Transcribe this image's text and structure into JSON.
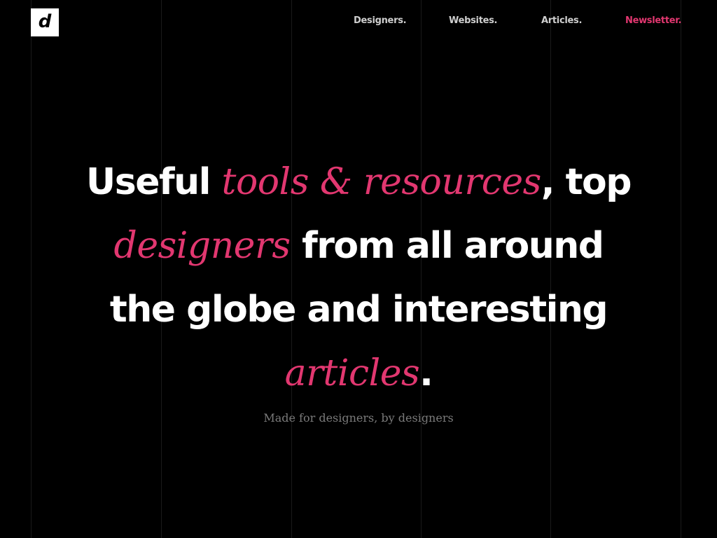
{
  "logo": {
    "letter": "d"
  },
  "nav": {
    "items": [
      {
        "label": "Designers."
      },
      {
        "label": "Websites."
      },
      {
        "label": "Articles."
      },
      {
        "label": "Newsletter."
      }
    ]
  },
  "hero": {
    "line1": {
      "a": "Useful ",
      "em": "tools & resources",
      "b": ", top"
    },
    "line2": {
      "em": "designers",
      "b": " from all around"
    },
    "line3": {
      "b": "the globe and interesting"
    },
    "line4": {
      "em": "articles",
      "b": "."
    }
  },
  "tagline": "Made for designers, by designers",
  "colors": {
    "background": "#000000",
    "accent": "#e23770",
    "text": "#ffffff",
    "nav_text": "#cfcfcf",
    "muted": "#7b7b7b"
  }
}
